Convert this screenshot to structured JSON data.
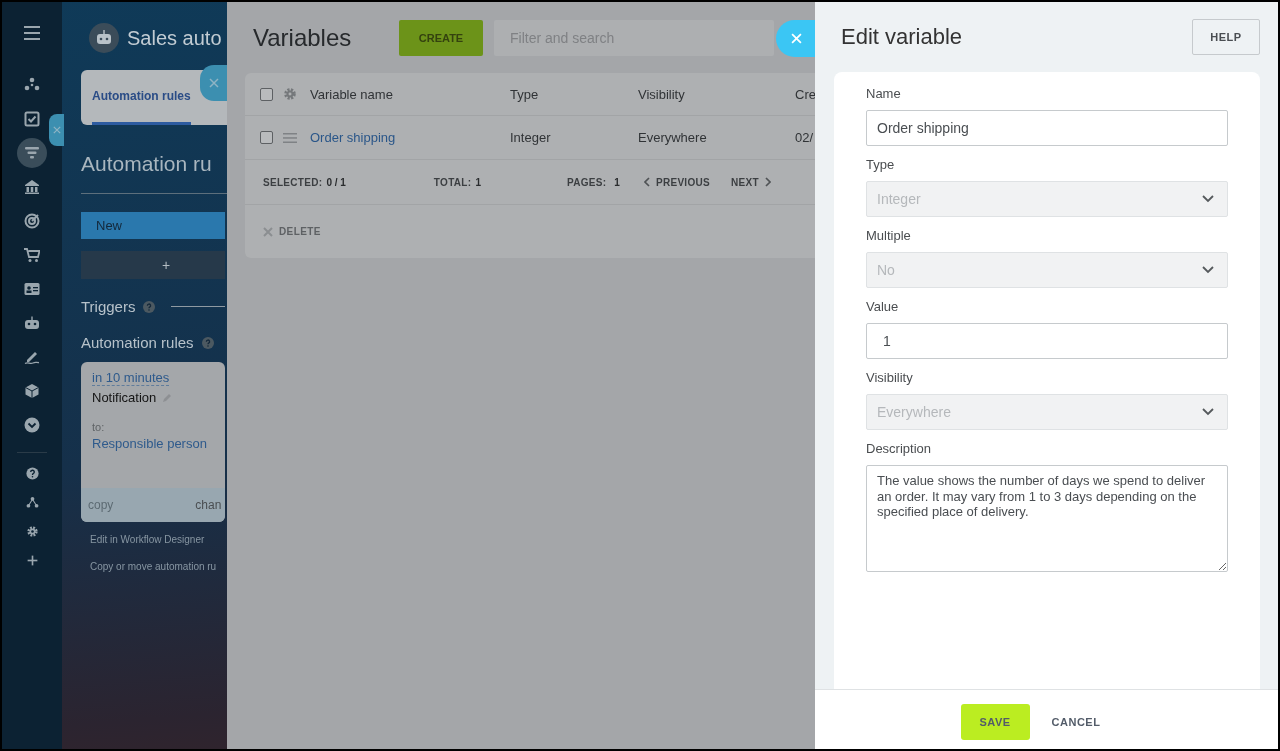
{
  "background_page": {
    "title": "Sales auto",
    "tab": {
      "label": "Automation rules",
      "selected": true
    },
    "heading": "Automation ru",
    "stage": "New",
    "add_button": "+",
    "triggers": "Triggers",
    "rules_heading": "Automation rules",
    "rule_card": {
      "delay": "in 10 minutes",
      "action": "Notification",
      "to_label": "to:",
      "recipient": "Responsible person",
      "copy": "copy",
      "change": "chan"
    },
    "links": [
      "Edit in Workflow Designer",
      "Copy or move automation ru"
    ]
  },
  "variables": {
    "title": "Variables",
    "create": "CREATE",
    "search": {
      "placeholder": "Filter and search"
    },
    "select_all": {
      "checked": false
    },
    "columns": [
      "Variable name",
      "Type",
      "Visibility",
      "Cre"
    ],
    "rows": [
      {
        "name": "Order shipping",
        "type": "Integer",
        "visibility": "Everywhere",
        "column_4": "02/",
        "checked": false
      }
    ],
    "footer": {
      "selected_label": "SELECTED:",
      "selected": "0 / 1",
      "total_label": "TOTAL:",
      "total": "1",
      "pages_label": "PAGES:",
      "pages": "1",
      "previous": "PREVIOUS",
      "next": "NEXT"
    },
    "delete": "DELETE"
  },
  "edit_panel": {
    "title": "Edit variable",
    "help": "HELP",
    "fields": [
      {
        "kind": "input",
        "label": "Name",
        "value": "Order shipping",
        "disabled": false
      },
      {
        "kind": "select",
        "label": "Type",
        "value": "Integer",
        "disabled": true
      },
      {
        "kind": "select",
        "label": "Multiple",
        "value": "No",
        "disabled": true
      },
      {
        "kind": "input",
        "label": "Value",
        "value": "1",
        "disabled": false
      },
      {
        "kind": "select",
        "label": "Visibility",
        "value": "Everywhere",
        "disabled": true
      },
      {
        "kind": "textarea",
        "label": "Description",
        "value": "The value shows the number of days we spend to deliver an order. It may vary from 1 to 3 days depending on the specified place of delivery.",
        "disabled": false
      }
    ],
    "save": "SAVE",
    "cancel": "CANCEL"
  }
}
